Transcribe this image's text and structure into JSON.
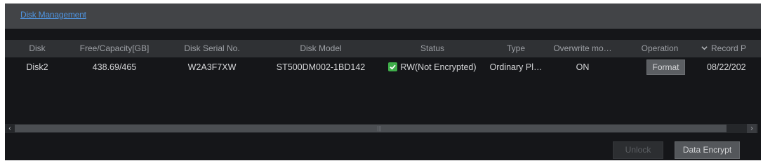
{
  "window": {
    "title": "Disk Management"
  },
  "table": {
    "columns": [
      "Disk",
      "Free/Capacity[GB]",
      "Disk Serial No.",
      "Disk Model",
      "Status",
      "Type",
      "Overwrite mo…",
      "Operation",
      "Record P"
    ],
    "sort_icon": "chevron-down-icon",
    "rows": [
      {
        "disk": "Disk2",
        "free_capacity": "438.69/465",
        "serial": "W2A3F7XW",
        "model": "ST500DM002-1BD142",
        "status": "RW(Not Encrypted)",
        "status_icon": "check-shield-icon",
        "type": "Ordinary Pl…",
        "overwrite": "ON",
        "operation": "Format",
        "record_period": "08/22/202"
      }
    ]
  },
  "scrollbar": {
    "left_arrow": "‹",
    "right_arrow": "›",
    "grip": "|||"
  },
  "footer": {
    "unlock_label": "Unlock",
    "encrypt_label": "Data Encrypt"
  },
  "colors": {
    "accent_link": "#4f94df",
    "status_ok": "#3fae4a",
    "background": "#151619"
  }
}
